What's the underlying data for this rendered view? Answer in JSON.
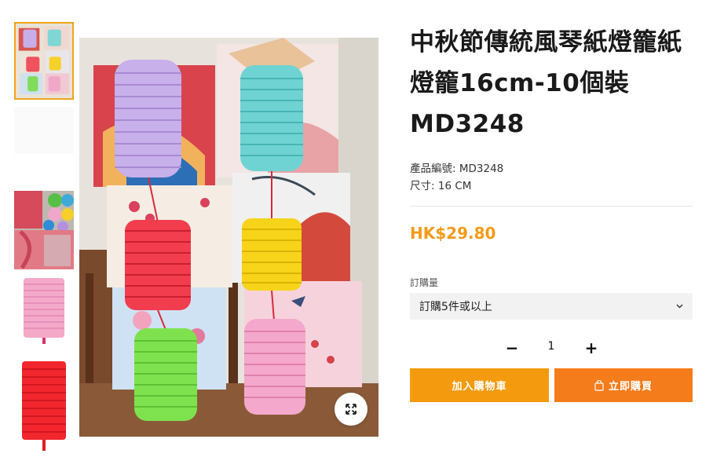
{
  "product": {
    "title": "中秋節傳統風琴紙燈籠紙燈籠16cm-10個裝MD3248",
    "code_label": "產品編號:",
    "code_value": "MD3248",
    "size_label": "尺寸:",
    "size_value": "16 CM",
    "price": "HK$29.80"
  },
  "order": {
    "quantity_label": "訂購量",
    "selected_option": "訂購5件或以上",
    "quantity": "1",
    "minus": "−",
    "plus": "+"
  },
  "buttons": {
    "add_to_cart": "加入購物車",
    "buy_now": "立即購買"
  },
  "icons": {
    "zoom": "expand-arrows-icon",
    "chevron": "chevron-down-icon",
    "bag": "shopping-bag-icon"
  },
  "colors": {
    "accent": "#f39a1a",
    "cart_button": "#f39a0e",
    "buy_button": "#f47c1b",
    "thumb_active_border": "#f2a31b"
  },
  "thumbnails": [
    {
      "name": "thumb-main-photo"
    },
    {
      "name": "thumb-blank"
    },
    {
      "name": "thumb-packaging"
    },
    {
      "name": "thumb-pink-lantern"
    },
    {
      "name": "thumb-red-lantern"
    }
  ]
}
